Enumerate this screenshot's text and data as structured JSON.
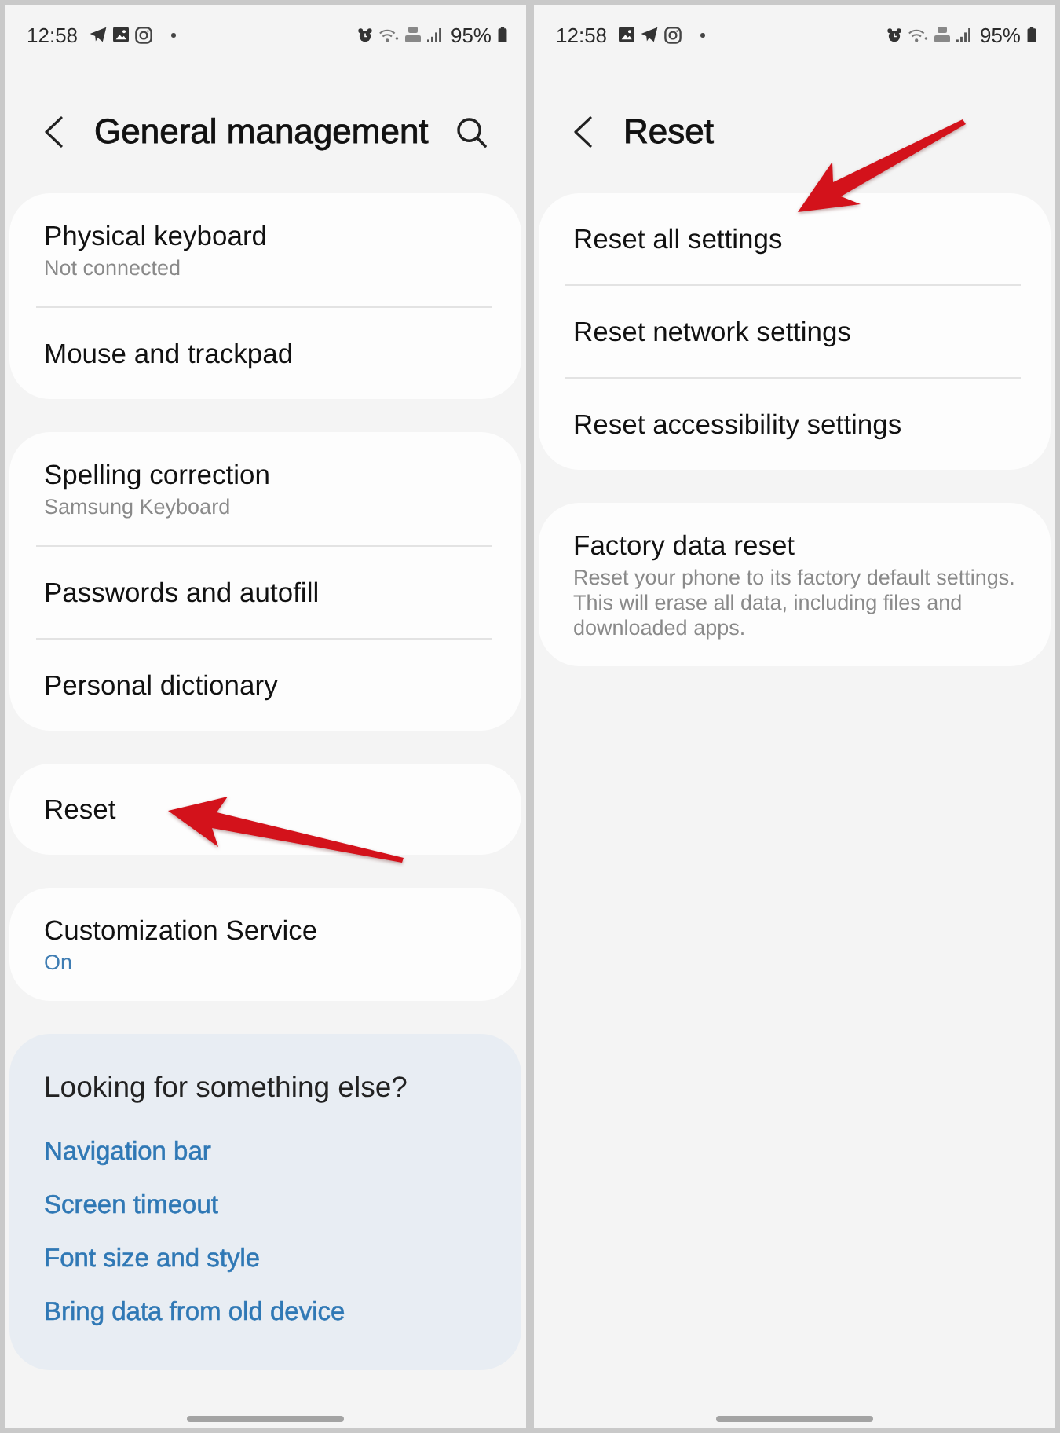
{
  "screens": [
    {
      "status_bar": {
        "time": "12:58",
        "notifications": [
          {
            "kind": "plane"
          },
          {
            "kind": "image"
          },
          {
            "kind": "camera"
          },
          {
            "kind": "dot"
          }
        ],
        "battery": "95%"
      },
      "header": {
        "title": "General management",
        "search": true
      },
      "sections": [
        {
          "items": [
            {
              "title": "Physical keyboard",
              "subtitle": "Not connected",
              "subtitle_highlighted": false
            },
            {
              "title": "Mouse and trackpad"
            }
          ]
        },
        {
          "items": [
            {
              "title": "Spelling correction",
              "subtitle": "Samsung Keyboard",
              "subtitle_highlighted": false
            },
            {
              "title": "Passwords and autofill"
            },
            {
              "title": "Personal dictionary"
            }
          ]
        },
        {
          "items": [
            {
              "title": "Reset",
              "annotation": {
                "kind": "left"
              }
            }
          ]
        },
        {
          "items": [
            {
              "title": "Customization Service",
              "subtitle": "On",
              "subtitle_highlighted": true
            }
          ]
        }
      ],
      "suggestions": {
        "title": "Looking for something else?",
        "links": [
          "Navigation bar",
          "Screen timeout",
          "Font size and style",
          "Bring data from old device"
        ]
      }
    },
    {
      "status_bar": {
        "time": "12:58",
        "notifications": [
          {
            "kind": "image"
          },
          {
            "kind": "plane"
          },
          {
            "kind": "camera"
          },
          {
            "kind": "dot"
          }
        ],
        "battery": "95%"
      },
      "header": {
        "title": "Reset",
        "search": false
      },
      "sections": [
        {
          "items": [
            {
              "title": "Reset all settings",
              "annotation": {
                "kind": "down_left"
              }
            },
            {
              "title": "Reset network settings"
            },
            {
              "title": "Reset accessibility settings"
            }
          ]
        },
        {
          "items": [
            {
              "title": "Factory data reset",
              "subtitle": "Reset your phone to its factory default settings. This will erase all data, including files and downloaded apps.",
              "subtitle_highlighted": false
            }
          ]
        }
      ]
    }
  ]
}
